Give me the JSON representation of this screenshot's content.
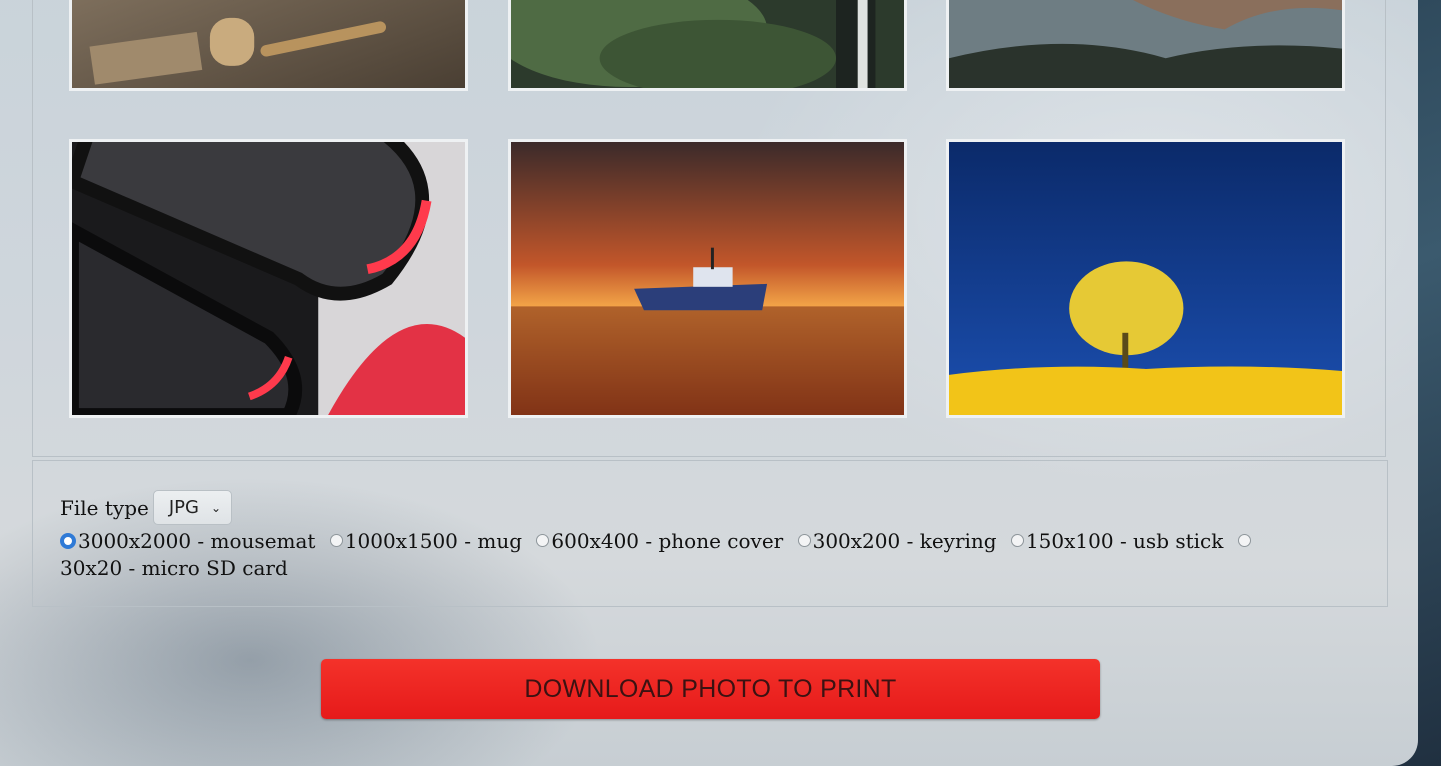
{
  "gallery": {
    "thumbnails": [
      {
        "name": "woodwork-tools-photo"
      },
      {
        "name": "fern-forest-photo"
      },
      {
        "name": "coastal-cliffs-photo"
      },
      {
        "name": "abstract-red-curves-photo"
      },
      {
        "name": "boat-sunset-photo"
      },
      {
        "name": "yellow-tree-blue-sky-photo"
      }
    ]
  },
  "options": {
    "file_type_label": "File type",
    "file_type_value": "JPG",
    "sizes": [
      {
        "label": "3000x2000 - mousemat",
        "checked": true
      },
      {
        "label": "1000x1500 - mug",
        "checked": false
      },
      {
        "label": "600x400 - phone cover",
        "checked": false
      },
      {
        "label": "300x200 - keyring",
        "checked": false
      },
      {
        "label": "150x100 - usb stick",
        "checked": false
      },
      {
        "label": "30x20 - micro SD card",
        "checked": false
      }
    ]
  },
  "download_button_label": "DOWNLOAD PHOTO TO PRINT",
  "colors": {
    "accent_button": "#e61a1a",
    "radio_selected": "#2f7ad6"
  }
}
